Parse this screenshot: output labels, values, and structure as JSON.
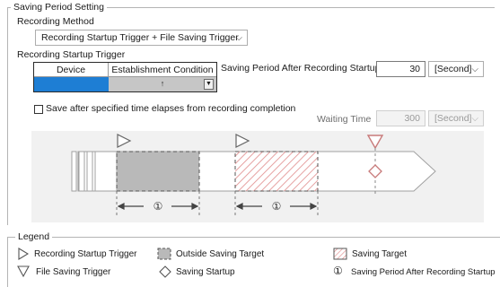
{
  "saving_period_setting": {
    "title": "Saving Period Setting",
    "recording_method_label": "Recording Method",
    "recording_method_value": "Recording Startup Trigger + File Saving Trigger",
    "recording_startup_trigger_label": "Recording Startup Trigger",
    "trigger_table": {
      "col_device": "Device",
      "col_condition": "Establishment Condition",
      "condition_value": "↑"
    },
    "saving_period_after_label": "Saving Period After Recording Startup",
    "saving_period_after_value": "30",
    "saving_period_after_unit": "[Second]",
    "save_after_label": "Save after specified time elapses from recording completion",
    "save_after_checked": false,
    "waiting_time_label": "Waiting Time",
    "waiting_time_value": "300",
    "waiting_time_unit": "[Second]",
    "diagram_period_marks": [
      "①",
      "①"
    ]
  },
  "legend": {
    "title": "Legend",
    "items": [
      {
        "icon": "outline-triangle-right-icon",
        "label": "Recording Startup Trigger"
      },
      {
        "icon": "outside-saving-target-swatch-icon",
        "label": "Outside Saving Target"
      },
      {
        "icon": "saving-target-swatch-icon",
        "label": "Saving Target"
      },
      {
        "icon": "outline-triangle-down-icon",
        "label": "File Saving Trigger"
      },
      {
        "icon": "diamond-icon",
        "label": "Saving Startup"
      },
      {
        "icon": "circled-one-icon",
        "symbol": "①",
        "label": "Saving Period After Recording Startup"
      }
    ]
  },
  "colors": {
    "selection_blue": "#1e7ed4",
    "saving_target_hatch": "#e08a8a",
    "outside_target_grey": "#b9b9b9",
    "file_trigger_marker": "#c87a7a"
  }
}
